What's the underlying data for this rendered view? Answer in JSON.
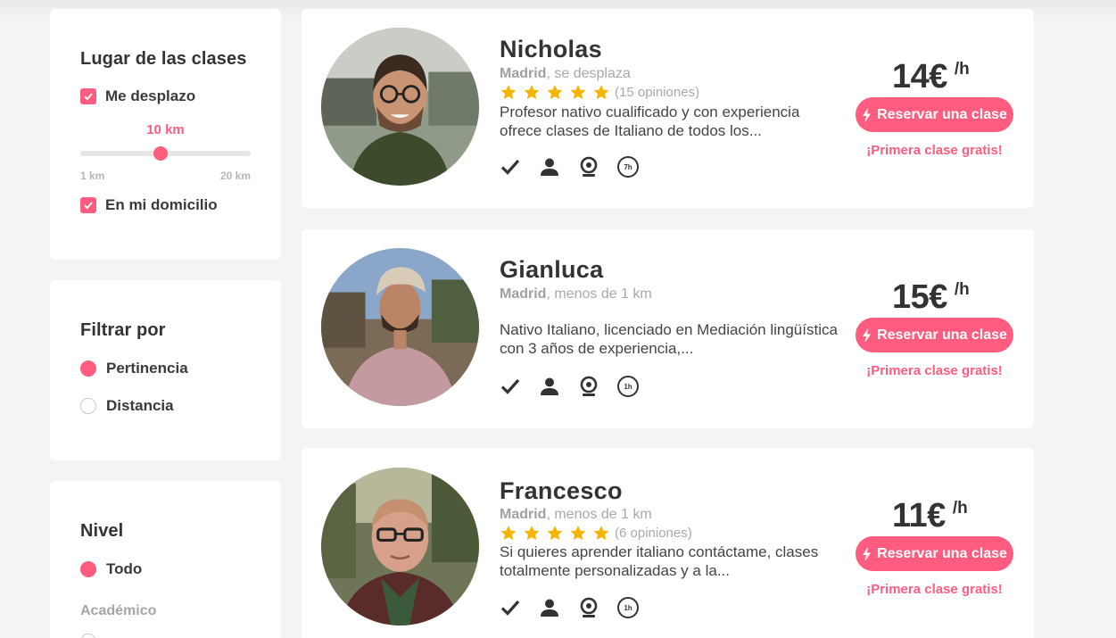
{
  "filters": {
    "location": {
      "title": "Lugar de las clases",
      "travel_label": "Me desplazo",
      "distance_value": "10 km",
      "distance_fraction": 0.47,
      "min_label": "1 km",
      "max_label": "20 km",
      "home_label": "En mi domicilio"
    },
    "sort": {
      "title": "Filtrar por",
      "options": [
        "Pertinencia",
        "Distancia"
      ],
      "selected": "Pertinencia"
    },
    "level": {
      "title": "Nivel",
      "option_all": "Todo",
      "group_label": "Académico"
    }
  },
  "teachers": [
    {
      "name": "Nicholas",
      "city": "Madrid",
      "distance": ", se desplaza",
      "rating": 5,
      "reviews": "(15 opiniones)",
      "description": "Profesor nativo cualificado y con experiencia ofrece clases de Italiano de todos los...",
      "response_time": "7h",
      "price": "14€",
      "per": "/h",
      "book_label": "Reservar una clase",
      "free_label": "¡Primera clase gratis!"
    },
    {
      "name": "Gianluca",
      "city": "Madrid",
      "distance": ", menos de 1 km",
      "rating": 0,
      "reviews": "",
      "description": "Nativo Italiano, licenciado en Mediación lingüística con 3 años de experiencia,...",
      "response_time": "1h",
      "price": "15€",
      "per": "/h",
      "book_label": "Reservar una clase",
      "free_label": "¡Primera clase gratis!"
    },
    {
      "name": "Francesco",
      "city": "Madrid",
      "distance": ", menos de 1 km",
      "rating": 5,
      "reviews": "(6 opiniones)",
      "description": "Si quieres aprender italiano contáctame, clases totalmente personalizadas y a la...",
      "response_time": "1h",
      "price": "11€",
      "per": "/h",
      "book_label": "Reservar una clase",
      "free_label": "¡Primera clase gratis!"
    }
  ],
  "icons": {
    "badges": [
      "verified-check-icon",
      "user-icon",
      "webcam-icon",
      "response-time-icon"
    ],
    "book": "lightning-icon",
    "star": "star-icon"
  },
  "colors": {
    "accent": "#ff5c7f",
    "star": "#f5b400",
    "background": "#f4f4f4"
  }
}
